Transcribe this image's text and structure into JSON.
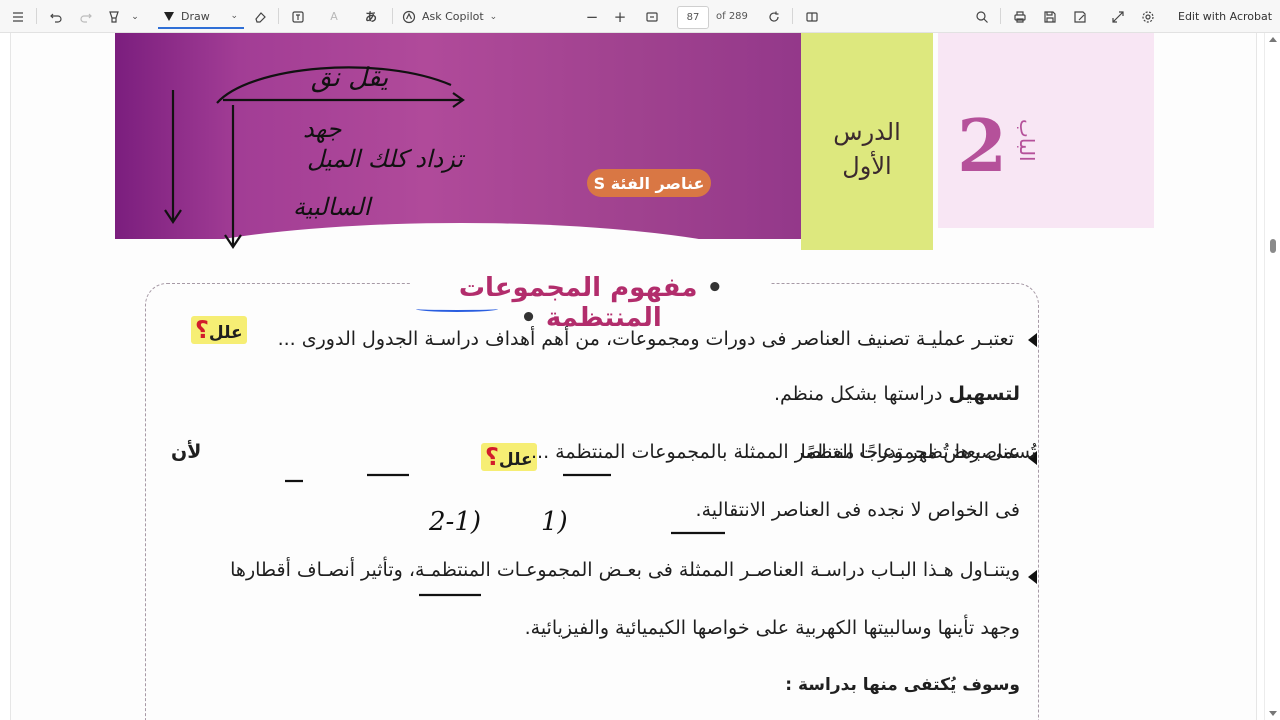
{
  "toolbar": {
    "draw_label": "Draw",
    "copilot_label": "Ask Copilot",
    "page_current": "87",
    "page_total": "of 289",
    "edit_acrobat": "Edit with Acrobat"
  },
  "banner": {
    "tag": "عناصر الفئة S",
    "lesson_line1": "الدرس",
    "lesson_line2": "الأول",
    "chapter_number": "2",
    "chapter_word": "الباب"
  },
  "content": {
    "heading": "مفهوم المجموعات المنتظمة",
    "p1_line1": "تعتبـر عمليـة تصنيف العناصر فى دورات ومجموعات، من أهم أهداف دراسـة الجدول الدورى ...",
    "p1_line2_bold": "لتسهيل",
    "p1_line2_rest": " دراستها بشكل منظم.",
    "p2_line1_a": "تُسمى بعض مجموعات العناصر الممثلة بالمجموعات المنتظمة ...",
    "p2_line1_bold": "لأن",
    "p2_line1_b": " عناصرها تُظهر تدرجًا منتظمًا",
    "p2_line2": "فى الخواص لا نجده فى العناصر الانتقالية.",
    "p3_line1": "ويتنـاول هـذا البـاب دراسـة العناصـر الممثلة فى بعـض المجموعـات المنتظمـة، وتأثير أنصـاف أقطارها",
    "p3_line2": "وجهد تأينها وسالبيتها الكهربية على خواصها الكيميائية والفيزيائية.",
    "p4": "وسوف يُكتفى منها بدراسة :",
    "why_label": "علل",
    "why_mark": "؟"
  },
  "handwriting": {
    "top": "يقل نق",
    "mid1": "جهد",
    "mid2": "تزداد كلك الميل",
    "mid3": "السالبية",
    "g1": "(1",
    "g2": "(2-1"
  }
}
